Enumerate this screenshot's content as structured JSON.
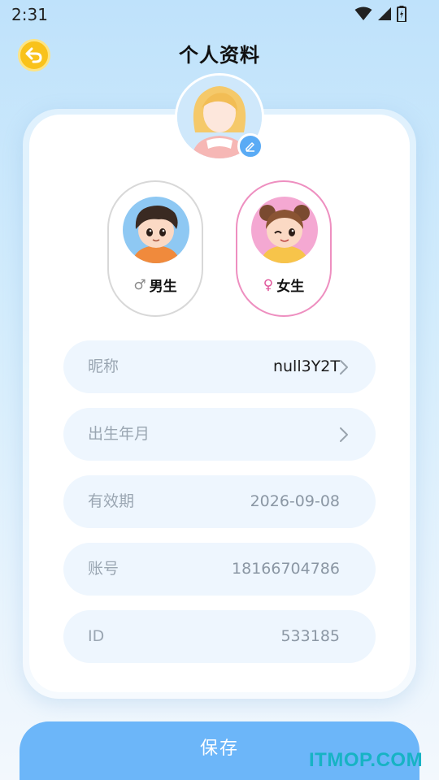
{
  "status_bar": {
    "time": "2:31",
    "icons": [
      "wifi-icon",
      "signal-icon",
      "battery-icon"
    ]
  },
  "header": {
    "title": "个人资料",
    "back_icon": "back-arrow-icon"
  },
  "avatar": {
    "icon": "avatar-girl-illustration",
    "edit_icon": "edit-pen-icon"
  },
  "gender": {
    "male": {
      "label": "男生",
      "symbol": "♂"
    },
    "female": {
      "label": "女生",
      "symbol": "♀"
    },
    "selected": "female"
  },
  "fields": [
    {
      "label": "昵称",
      "value": "null3Y2T",
      "arrow": true
    },
    {
      "label": "出生年月",
      "value": "",
      "arrow": true
    },
    {
      "label": "有效期",
      "value": "2026-09-08",
      "arrow": false
    },
    {
      "label": "账号",
      "value": "18166704786",
      "arrow": false
    },
    {
      "label": "ID",
      "value": "533185",
      "arrow": false
    }
  ],
  "save_button": {
    "label": "保存"
  },
  "watermark": "ITMOP.COM",
  "colors": {
    "accent": "#6cb6f9",
    "back_button": "#f9c21b",
    "female_border": "#ee8fc0",
    "field_bg": "#eef6fe"
  }
}
